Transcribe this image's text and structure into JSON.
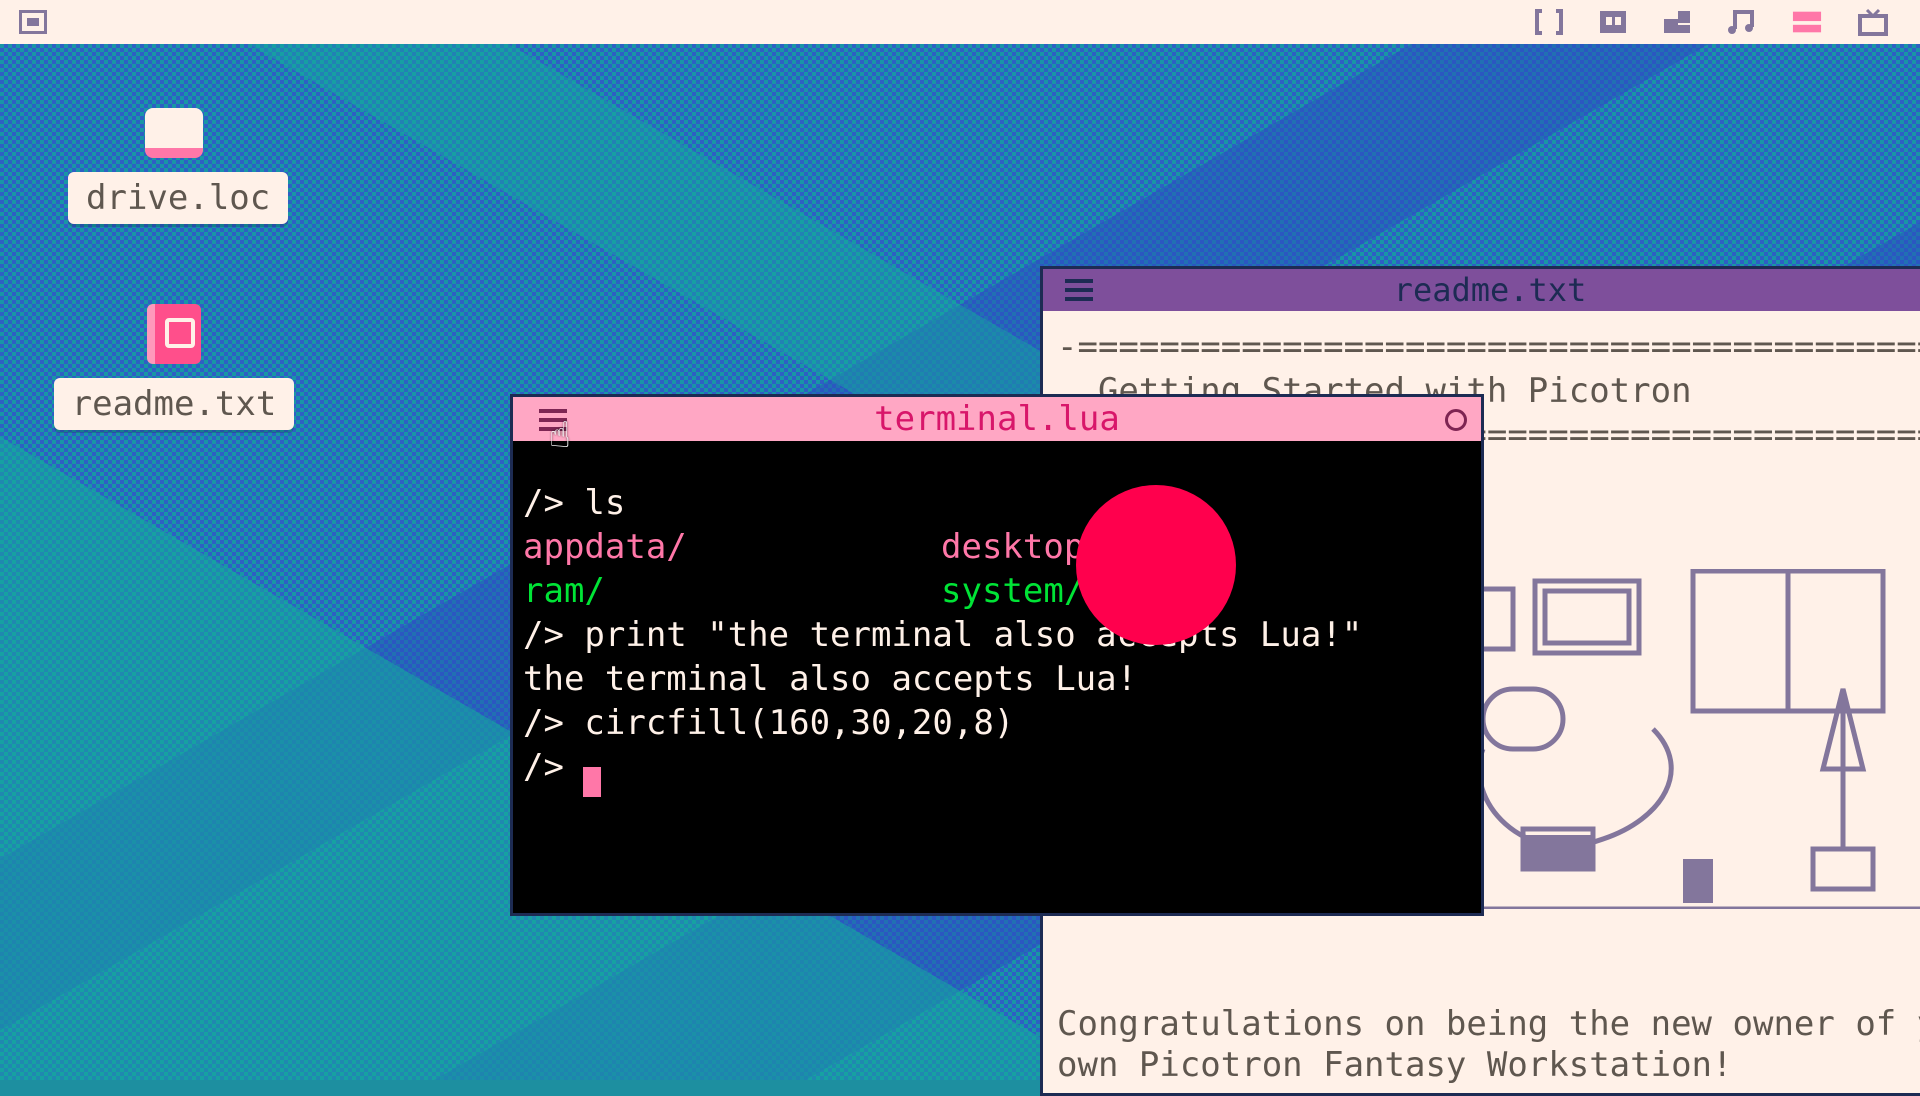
{
  "topbar": {
    "logo_icon": "picotron-logo-icon",
    "right_icons": [
      "code-editor-icon",
      "sprite-editor-icon",
      "map-editor-icon",
      "music-icon",
      "sfx-icon",
      "run-cartridge-icon"
    ]
  },
  "desktop": {
    "items": [
      {
        "label": "drive.loc",
        "icon": "drive-icon"
      },
      {
        "label": "readme.txt",
        "icon": "book-icon"
      }
    ]
  },
  "readme_window": {
    "title": "readme.txt",
    "lines": [
      "-==================================================",
      "  Getting Started with Picotron",
      "  ================================================",
      "Congratulations on being the new owner of your",
      "own Picotron Fantasy Workstation!"
    ]
  },
  "terminal_window": {
    "title": "terminal.lua",
    "lines": [
      {
        "text": "/> ls",
        "color": "white"
      },
      {
        "text": "appdata/",
        "color": "pink"
      },
      {
        "text": "desktop/",
        "color": "pink"
      },
      {
        "text": "ram/",
        "color": "green"
      },
      {
        "text": "system/",
        "color": "green"
      },
      {
        "text": "/> print \"the terminal also accepts Lua!\"",
        "color": "white"
      },
      {
        "text": "the terminal also accepts Lua!",
        "color": "white"
      },
      {
        "text": "/> circfill(160,30,20,8)",
        "color": "white"
      },
      {
        "text": "/> ",
        "color": "white"
      }
    ],
    "circle_color": "#ff004d"
  },
  "colors": {
    "topbar_bg": "#fff1e8",
    "readme_titlebar": "#7e4f9b",
    "terminal_titlebar": "#ffa7c4",
    "terminal_title_text": "#d8166a"
  }
}
